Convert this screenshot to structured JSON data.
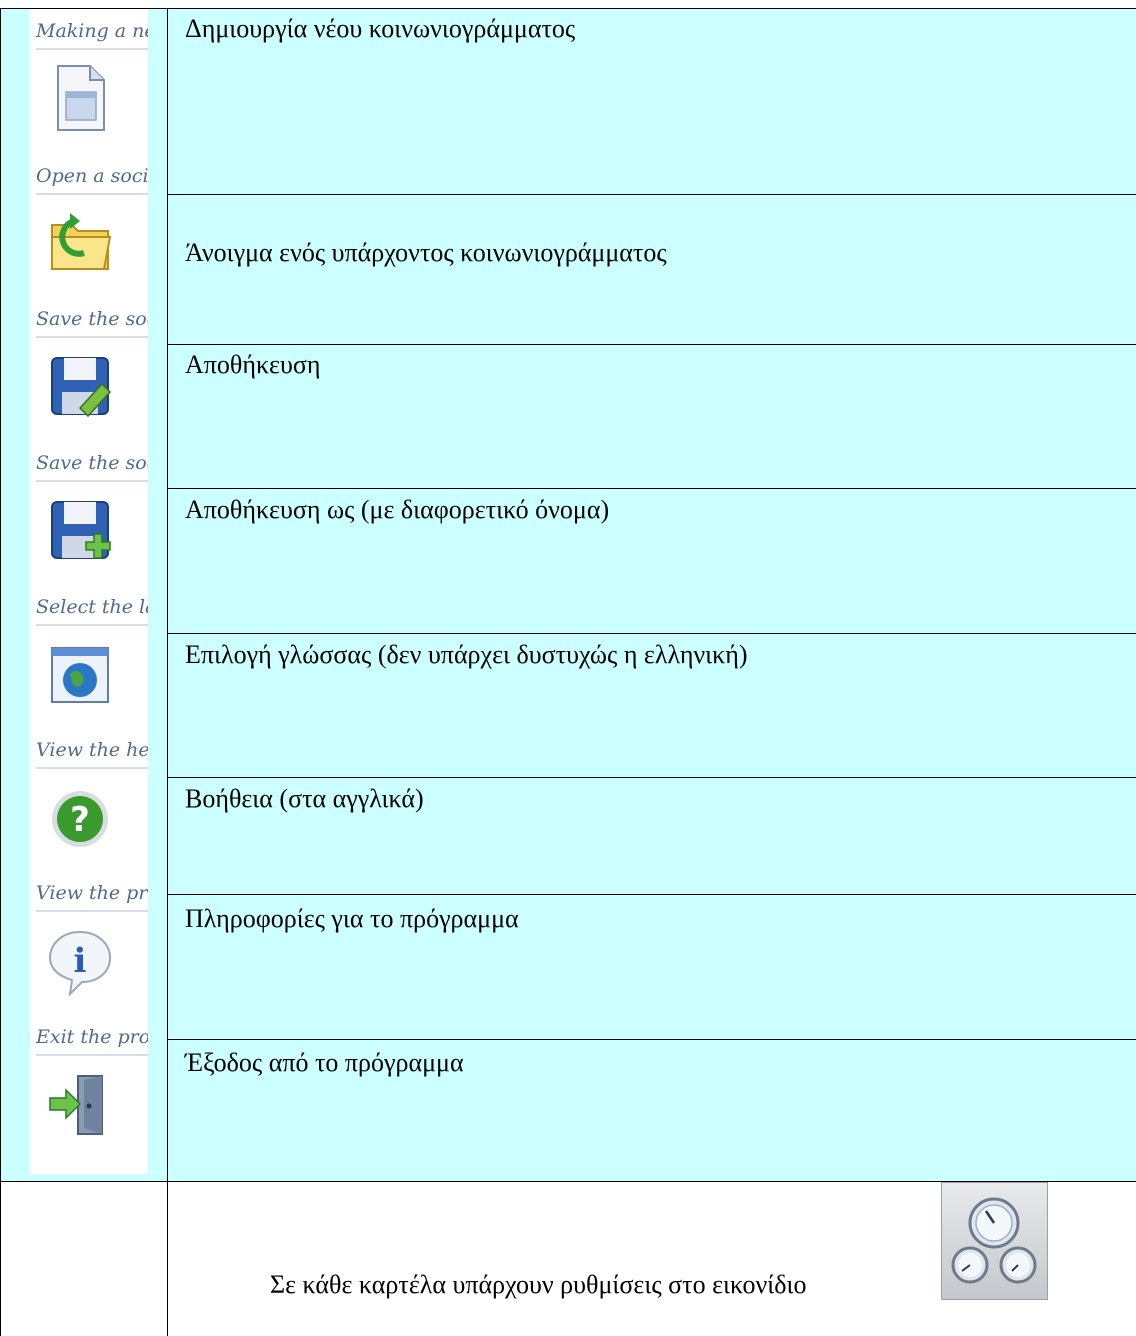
{
  "rows": [
    {
      "icon_label": "Making a ne",
      "icon": "new-document-icon",
      "description": "Δημιουργία νέου κοινωνιογράμματος"
    },
    {
      "icon_label": "Open a socio",
      "icon": "open-folder-icon",
      "description": "Άνοιγμα ενός υπάρχοντος κοινωνιογράμματος"
    },
    {
      "icon_label": "Save the soc",
      "icon": "save-icon",
      "description": "Αποθήκευση"
    },
    {
      "icon_label": "Save the soc",
      "icon": "save-as-icon",
      "description": "Αποθήκευση ως (με διαφορετικό όνομα)"
    },
    {
      "icon_label": "Select the la",
      "icon": "language-globe-icon",
      "description": "Επιλογή γλώσσας (δεν υπάρχει δυστυχώς η ελληνική)"
    },
    {
      "icon_label": "View the he",
      "icon": "help-icon",
      "description": "Βοήθεια (στα αγγλικά)"
    },
    {
      "icon_label": "View the pr",
      "icon": "info-icon",
      "description": "Πληροφορίες για το πρόγραμμα"
    },
    {
      "icon_label": "Exit the pro",
      "icon": "exit-door-icon",
      "description": "Έξοδος από το πρόγραμμα"
    }
  ],
  "footer": {
    "text": "Σε κάθε καρτέλα υπάρχουν ρυθμίσεις στο εικονίδιο",
    "icon": "settings-gauges-icon"
  },
  "colors": {
    "cell_background": "#ccffff",
    "label": "#4f6b8c"
  }
}
